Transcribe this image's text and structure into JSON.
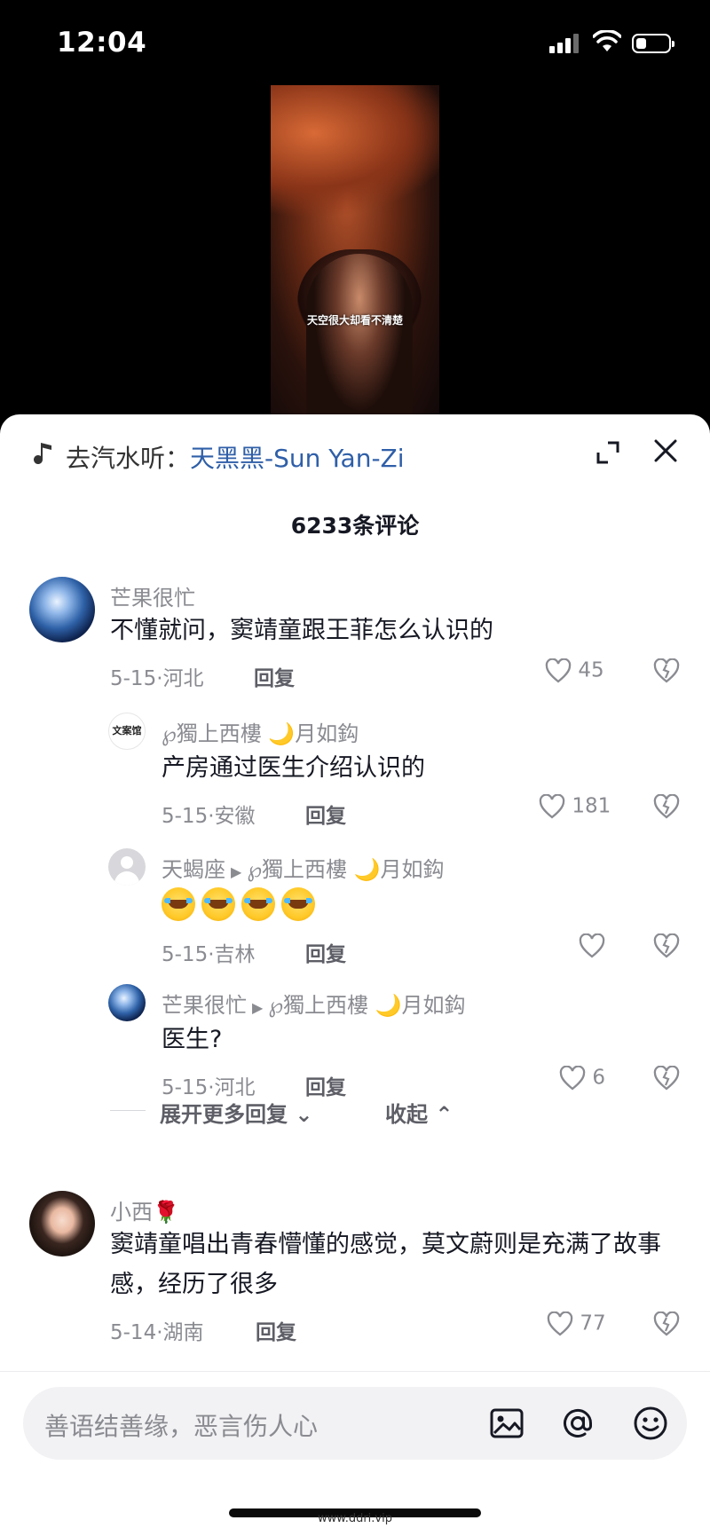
{
  "status_bar": {
    "time": "12:04"
  },
  "video": {
    "subtitle": "天空很大却看不清楚"
  },
  "header": {
    "prefix": "去汽水听：",
    "song": "天黑黑-Sun Yan-Zi"
  },
  "comment_count": "6233条评论",
  "comments": [
    {
      "user": "芒果很忙",
      "text": "不懂就问，窦靖童跟王菲怎么认识的",
      "date": "5-15",
      "location": "河北",
      "reply": "回复",
      "likes": "45"
    },
    {
      "user": "℘獨上西樓 🌙月如鈎",
      "avatar_text": "文案馆",
      "text": "产房通过医生介绍认识的",
      "date": "5-15",
      "location": "安徽",
      "reply": "回复",
      "likes": "181"
    },
    {
      "user": "天蝎座",
      "reply_to": "℘獨上西樓 🌙月如鈎",
      "date": "5-15",
      "location": "吉林",
      "reply": "回复",
      "likes": ""
    },
    {
      "user": "芒果很忙",
      "reply_to": "℘獨上西樓 🌙月如鈎",
      "text": "医生?",
      "date": "5-15",
      "location": "河北",
      "reply": "回复",
      "likes": "6"
    },
    {
      "user": "小西🌹",
      "text": "窦靖童唱出青春懵懂的感觉，莫文蔚则是充满了故事感，经历了很多",
      "date": "5-14",
      "location": "湖南",
      "reply": "回复",
      "likes": "77"
    }
  ],
  "expand_more": "展开更多回复",
  "collapse": "收起",
  "input": {
    "placeholder": "善语结善缘，恶言伤人心"
  },
  "watermark": "www.ddri.vip",
  "icons": [
    "music-note-icon",
    "expand-icon",
    "close-icon",
    "heart-icon",
    "dislike-icon",
    "image-icon",
    "at-icon",
    "emoji-icon"
  ]
}
